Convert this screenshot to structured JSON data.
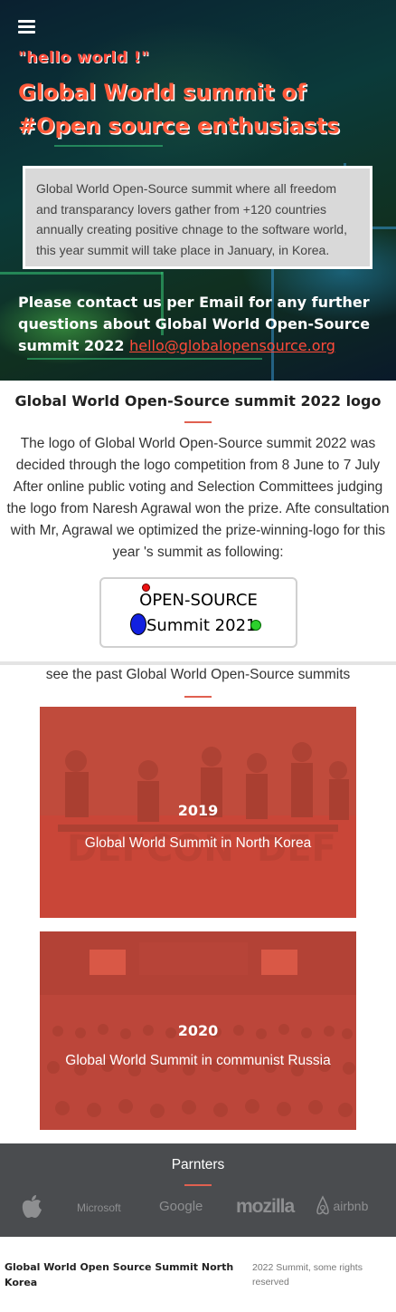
{
  "hero": {
    "kicker": "\"hello world !\"",
    "title": "Global World summit of #Open source enthusiasts",
    "description": "Global World Open-Source summit where all freedom and transparancy lovers gather from +120 countries annually creating positive chnage to the software world, this year summit will take place in January, in Korea.",
    "contact_text": "Please contact us per Email for any further questions about Global World Open-Source summit 2022",
    "contact_email": "hello@globalopensource.org"
  },
  "logo_section": {
    "heading": "Global World Open-Source summit 2022 logo",
    "description": "The logo of Global World Open-Source summit 2022 was decided through the logo competition from 8 June to 7 July After online public voting and Selection Committees judging the logo from Naresh Agrawal won the prize. Afte consultation with Mr, Agrawal we optimized the prize-winning-logo for this year 's summit as following:",
    "logo_line1": "OPEN-SOURCE",
    "logo_line2": "Summit 2021",
    "accent_color": "#e06050"
  },
  "past_summits": {
    "label": "see the past Global World Open-Source summits",
    "items": [
      {
        "year": "2019",
        "name": "Global World Summit in North Korea"
      },
      {
        "year": "2020",
        "name": "Global World Summit in communist Russia"
      }
    ]
  },
  "partners": {
    "title": "Parnters",
    "logos": [
      "apple-logo",
      "Microsoft",
      "Google",
      "mozilla",
      "airbnb"
    ]
  },
  "footer": {
    "title": "Global World Open Source Summit North Korea",
    "rights": "2022 Summit, some rights reserved"
  }
}
